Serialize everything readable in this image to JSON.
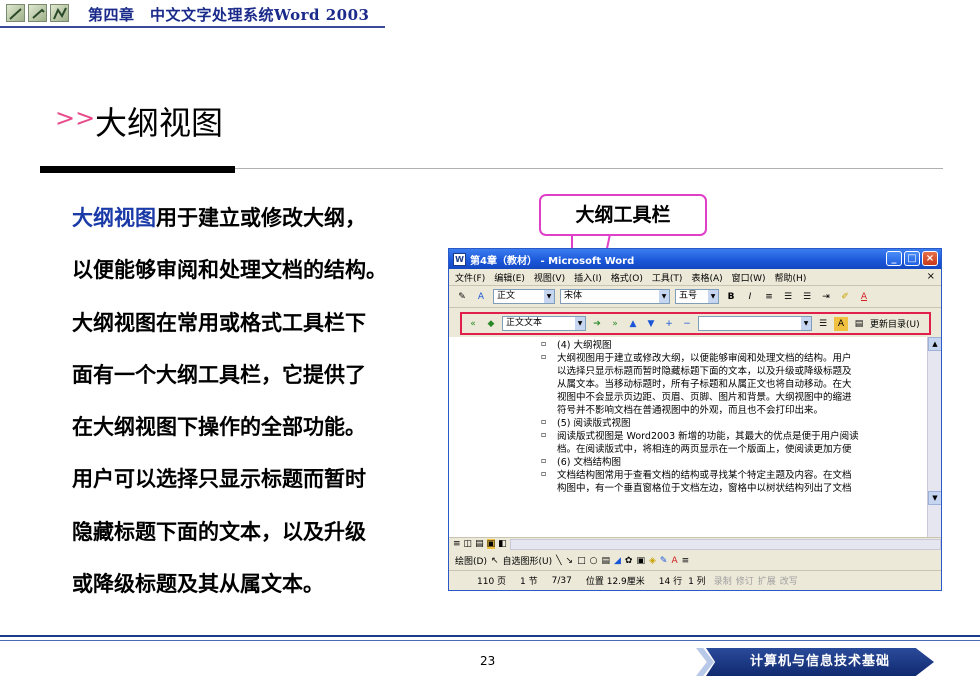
{
  "header": {
    "title": "第四章　中文文字处理系统Word 2003"
  },
  "slide": {
    "title_arrow": ">>",
    "title": "大纲视图",
    "paragraph_lines": [
      {
        "highlight": "大纲视图",
        "text": "用于建立或修改大纲，"
      },
      {
        "highlight": "",
        "text": "以便能够审阅和处理文档的结构。"
      },
      {
        "highlight": "",
        "text": "大纲视图在常用或格式工具栏下"
      },
      {
        "highlight": "",
        "text": "面有一个大纲工具栏，它提供了"
      },
      {
        "highlight": "",
        "text": "在大纲视图下操作的全部功能。"
      },
      {
        "highlight": "",
        "text": "用户可以选择只显示标题而暂时"
      },
      {
        "highlight": "",
        "text": "隐藏标题下面的文本，以及升级"
      },
      {
        "highlight": "",
        "text": "或降级标题及其从属文本。"
      }
    ],
    "callout": "大纲工具栏"
  },
  "word_window": {
    "title": "第4章（教材） - Microsoft Word",
    "menu": [
      "文件(F)",
      "编辑(E)",
      "视图(V)",
      "插入(I)",
      "格式(O)",
      "工具(T)",
      "表格(A)",
      "窗口(W)",
      "帮助(H)"
    ],
    "close_doc": "×",
    "format_toolbar": {
      "style": "正文",
      "font": "宋体",
      "size": "五号",
      "bold": "B",
      "italic": "I"
    },
    "outline_toolbar": {
      "level": "正文文本",
      "update_toc": "更新目录(U)"
    },
    "doc_lines": [
      {
        "bullet": true,
        "text": "(4) 大纲视图"
      },
      {
        "bullet": true,
        "text": "大纲视图用于建立或修改大纲，以便能够审阅和处理文档的结构。用户"
      },
      {
        "bullet": false,
        "text": "以选择只显示标题而暂时隐藏标题下面的文本，以及升级或降级标题及"
      },
      {
        "bullet": false,
        "text": "从属文本。当移动标题时，所有子标题和从属正文也将自动移动。在大"
      },
      {
        "bullet": false,
        "text": "视图中不会显示页边距、页眉、页脚、图片和背景。大纲视图中的缩进"
      },
      {
        "bullet": false,
        "text": "符号并不影响文档在普通视图中的外观，而且也不会打印出来。"
      },
      {
        "bullet": true,
        "text": "(5) 阅读版式视图"
      },
      {
        "bullet": true,
        "text": "阅读版式视图是 Word2003 新增的功能，其最大的优点是便于用户阅读"
      },
      {
        "bullet": false,
        "text": "档。在阅读版式中，将相连的两页显示在一个版面上，使阅读更加方便"
      },
      {
        "bullet": true,
        "text": "(6) 文档结构图"
      },
      {
        "bullet": true,
        "text": "文档结构图常用于查看文档的结构或寻找某个特定主题及内容。在文档"
      },
      {
        "bullet": false,
        "text": "构图中，有一个垂直窗格位于文档左边，窗格中以树状结构列出了文档"
      }
    ],
    "draw_toolbar": {
      "draw": "绘图(D)",
      "autoshapes": "自选图形(U)"
    },
    "status": {
      "page": "110 页",
      "section": "1 节",
      "pages": "7/37",
      "position": "位置 12.9厘米",
      "line": "14 行",
      "col": "1 列",
      "rec": "录制",
      "trk": "修订",
      "ext": "扩展",
      "ovr": "改写"
    }
  },
  "footer": {
    "page_number": "23",
    "badge": "计算机与信息技术基础"
  },
  "colors": {
    "header_blue": "#1a2a8a",
    "highlight_blue": "#1a3aa8",
    "callout_pink": "#e040c8",
    "outline_box_red": "#e0204a"
  }
}
